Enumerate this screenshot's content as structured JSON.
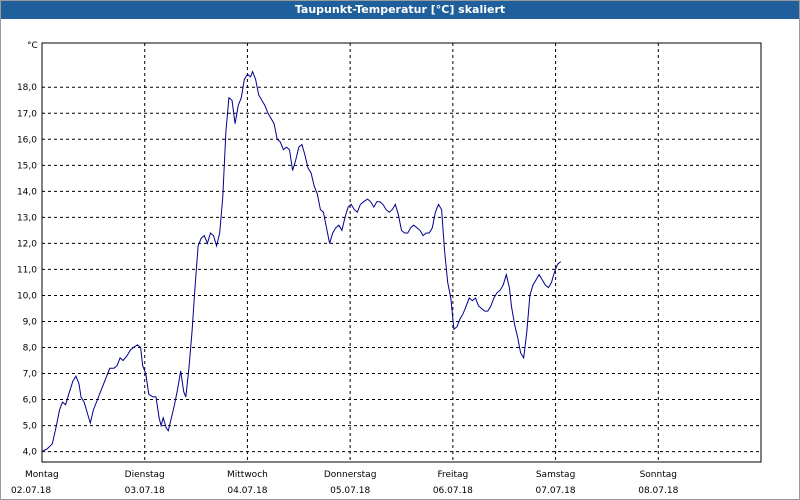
{
  "window": {
    "title": "Taupunkt-Temperatur [°C] skaliert"
  },
  "chart_data": {
    "type": "line",
    "title": "Taupunkt-Temperatur [°C] skaliert",
    "y_unit": "°C",
    "ylim": [
      3.6,
      19.7
    ],
    "y_ticks": [
      4.0,
      5.0,
      6.0,
      7.0,
      8.0,
      9.0,
      10.0,
      11.0,
      12.0,
      13.0,
      14.0,
      15.0,
      16.0,
      17.0,
      18.0
    ],
    "y_tick_labels": [
      "4,0",
      "5,0",
      "6,0",
      "7,0",
      "8,0",
      "9,0",
      "10,0",
      "11,0",
      "12,0",
      "13,0",
      "14,0",
      "15,0",
      "16,0",
      "17,0",
      "18,0"
    ],
    "xlim": [
      0,
      7
    ],
    "x_ticks": [
      0,
      1,
      2,
      3,
      4,
      5,
      6
    ],
    "x_tick_labels": [
      {
        "day": "Montag",
        "date": "02.07.18"
      },
      {
        "day": "Dienstag",
        "date": "03.07.18"
      },
      {
        "day": "Mittwoch",
        "date": "04.07.18"
      },
      {
        "day": "Donnerstag",
        "date": "05.07.18"
      },
      {
        "day": "Freitag",
        "date": "06.07.18"
      },
      {
        "day": "Samstag",
        "date": "07.07.18"
      },
      {
        "day": "Sonntag",
        "date": "08.07.18"
      }
    ],
    "x_axis_note": "x in days since first date tick (Montag 02.07.18 00:00)",
    "grid": true,
    "line_color": "#00008b",
    "series": [
      {
        "name": "Taupunkt",
        "points": [
          [
            0.0,
            4.0
          ],
          [
            0.05,
            4.1
          ],
          [
            0.1,
            4.3
          ],
          [
            0.14,
            5.0
          ],
          [
            0.17,
            5.6
          ],
          [
            0.2,
            5.9
          ],
          [
            0.23,
            5.8
          ],
          [
            0.26,
            6.2
          ],
          [
            0.3,
            6.7
          ],
          [
            0.33,
            6.9
          ],
          [
            0.36,
            6.6
          ],
          [
            0.38,
            6.1
          ],
          [
            0.41,
            5.9
          ],
          [
            0.44,
            5.5
          ],
          [
            0.47,
            5.1
          ],
          [
            0.5,
            5.6
          ],
          [
            0.54,
            6.0
          ],
          [
            0.56,
            6.2
          ],
          [
            0.6,
            6.6
          ],
          [
            0.63,
            6.9
          ],
          [
            0.66,
            7.2
          ],
          [
            0.7,
            7.2
          ],
          [
            0.73,
            7.3
          ],
          [
            0.76,
            7.6
          ],
          [
            0.79,
            7.5
          ],
          [
            0.83,
            7.7
          ],
          [
            0.86,
            7.9
          ],
          [
            0.89,
            8.0
          ],
          [
            0.93,
            8.1
          ],
          [
            0.96,
            8.0
          ],
          [
            0.98,
            7.3
          ],
          [
            1.01,
            7.0
          ],
          [
            1.04,
            6.2
          ],
          [
            1.08,
            6.1
          ],
          [
            1.11,
            6.1
          ],
          [
            1.14,
            5.3
          ],
          [
            1.16,
            5.0
          ],
          [
            1.18,
            5.3
          ],
          [
            1.21,
            4.9
          ],
          [
            1.23,
            4.8
          ],
          [
            1.26,
            5.3
          ],
          [
            1.29,
            5.8
          ],
          [
            1.32,
            6.4
          ],
          [
            1.35,
            7.1
          ],
          [
            1.38,
            6.3
          ],
          [
            1.4,
            6.1
          ],
          [
            1.43,
            7.2
          ],
          [
            1.46,
            8.6
          ],
          [
            1.49,
            10.3
          ],
          [
            1.52,
            11.9
          ],
          [
            1.55,
            12.2
          ],
          [
            1.58,
            12.3
          ],
          [
            1.61,
            12.0
          ],
          [
            1.64,
            12.4
          ],
          [
            1.67,
            12.3
          ],
          [
            1.7,
            11.9
          ],
          [
            1.73,
            12.4
          ],
          [
            1.76,
            13.8
          ],
          [
            1.79,
            16.3
          ],
          [
            1.82,
            17.6
          ],
          [
            1.85,
            17.5
          ],
          [
            1.88,
            16.6
          ],
          [
            1.91,
            17.3
          ],
          [
            1.94,
            17.6
          ],
          [
            1.97,
            18.3
          ],
          [
            2.0,
            18.5
          ],
          [
            2.03,
            18.4
          ],
          [
            2.05,
            18.6
          ],
          [
            2.08,
            18.3
          ],
          [
            2.11,
            17.7
          ],
          [
            2.14,
            17.5
          ],
          [
            2.17,
            17.3
          ],
          [
            2.2,
            17.0
          ],
          [
            2.23,
            16.8
          ],
          [
            2.26,
            16.6
          ],
          [
            2.29,
            16.0
          ],
          [
            2.32,
            15.9
          ],
          [
            2.35,
            15.6
          ],
          [
            2.38,
            15.7
          ],
          [
            2.41,
            15.6
          ],
          [
            2.44,
            14.8
          ],
          [
            2.47,
            15.2
          ],
          [
            2.5,
            15.7
          ],
          [
            2.53,
            15.8
          ],
          [
            2.56,
            15.4
          ],
          [
            2.59,
            14.9
          ],
          [
            2.62,
            14.7
          ],
          [
            2.65,
            14.2
          ],
          [
            2.68,
            13.9
          ],
          [
            2.71,
            13.3
          ],
          [
            2.74,
            13.2
          ],
          [
            2.77,
            12.6
          ],
          [
            2.8,
            12.0
          ],
          [
            2.83,
            12.4
          ],
          [
            2.86,
            12.6
          ],
          [
            2.89,
            12.7
          ],
          [
            2.92,
            12.5
          ],
          [
            2.95,
            13.0
          ],
          [
            2.98,
            13.4
          ],
          [
            3.01,
            13.5
          ],
          [
            3.04,
            13.3
          ],
          [
            3.07,
            13.2
          ],
          [
            3.1,
            13.5
          ],
          [
            3.13,
            13.6
          ],
          [
            3.17,
            13.7
          ],
          [
            3.2,
            13.6
          ],
          [
            3.23,
            13.4
          ],
          [
            3.26,
            13.6
          ],
          [
            3.29,
            13.6
          ],
          [
            3.32,
            13.5
          ],
          [
            3.35,
            13.3
          ],
          [
            3.38,
            13.2
          ],
          [
            3.41,
            13.3
          ],
          [
            3.44,
            13.5
          ],
          [
            3.47,
            13.1
          ],
          [
            3.5,
            12.5
          ],
          [
            3.53,
            12.4
          ],
          [
            3.56,
            12.4
          ],
          [
            3.59,
            12.6
          ],
          [
            3.62,
            12.7
          ],
          [
            3.65,
            12.6
          ],
          [
            3.68,
            12.5
          ],
          [
            3.71,
            12.3
          ],
          [
            3.74,
            12.4
          ],
          [
            3.77,
            12.4
          ],
          [
            3.8,
            12.6
          ],
          [
            3.83,
            13.2
          ],
          [
            3.86,
            13.5
          ],
          [
            3.89,
            13.3
          ],
          [
            3.92,
            11.7
          ],
          [
            3.95,
            10.5
          ],
          [
            3.98,
            9.9
          ],
          [
            4.01,
            8.7
          ],
          [
            4.04,
            8.8
          ],
          [
            4.07,
            9.1
          ],
          [
            4.1,
            9.3
          ],
          [
            4.13,
            9.6
          ],
          [
            4.16,
            9.9
          ],
          [
            4.19,
            9.8
          ],
          [
            4.22,
            9.9
          ],
          [
            4.25,
            9.6
          ],
          [
            4.28,
            9.5
          ],
          [
            4.31,
            9.4
          ],
          [
            4.34,
            9.4
          ],
          [
            4.37,
            9.6
          ],
          [
            4.4,
            9.9
          ],
          [
            4.43,
            10.1
          ],
          [
            4.46,
            10.2
          ],
          [
            4.49,
            10.4
          ],
          [
            4.52,
            10.8
          ],
          [
            4.55,
            10.3
          ],
          [
            4.57,
            9.6
          ],
          [
            4.6,
            8.9
          ],
          [
            4.63,
            8.4
          ],
          [
            4.66,
            7.8
          ],
          [
            4.69,
            7.6
          ],
          [
            4.72,
            8.6
          ],
          [
            4.75,
            10.0
          ],
          [
            4.78,
            10.4
          ],
          [
            4.81,
            10.6
          ],
          [
            4.84,
            10.8
          ],
          [
            4.87,
            10.6
          ],
          [
            4.9,
            10.4
          ],
          [
            4.93,
            10.3
          ],
          [
            4.96,
            10.5
          ],
          [
            4.99,
            10.9
          ],
          [
            5.02,
            11.2
          ],
          [
            5.05,
            11.3
          ]
        ]
      }
    ]
  }
}
